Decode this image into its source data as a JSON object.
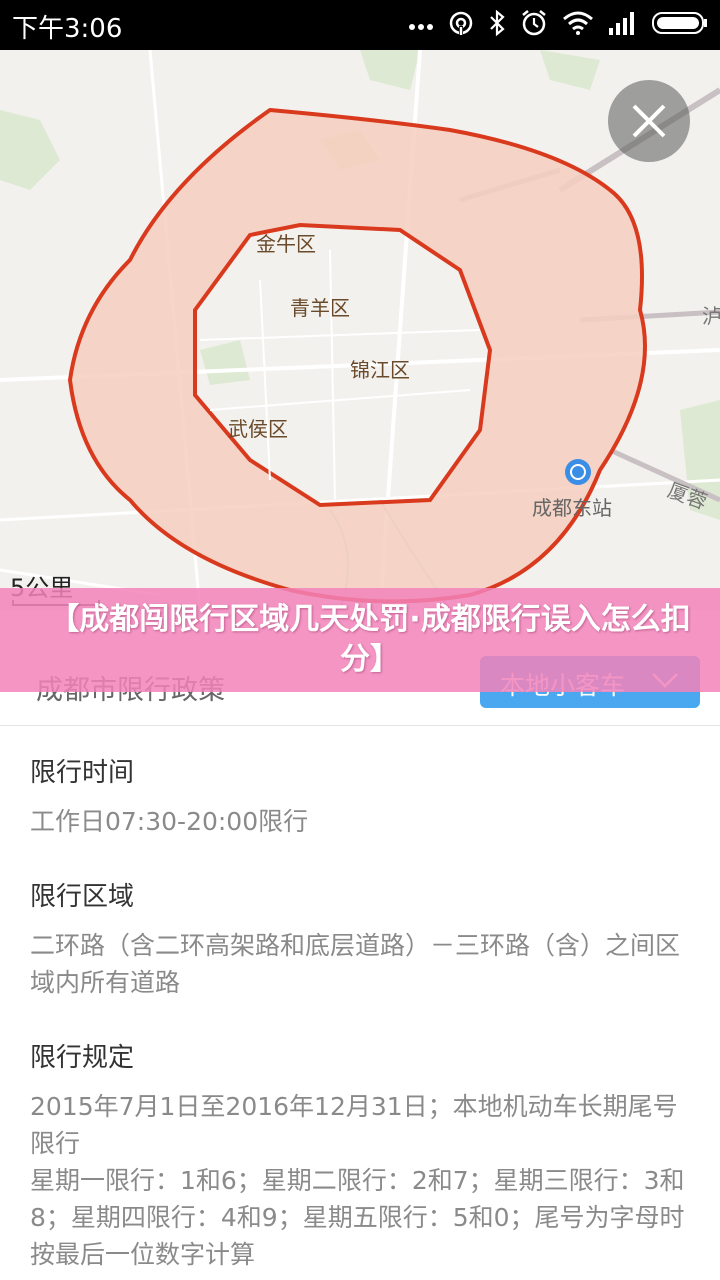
{
  "status_bar": {
    "time": "下午3:06"
  },
  "map": {
    "labels": {
      "jinniu": "金牛区",
      "qingyang": "青羊区",
      "jinjiang": "锦江区",
      "wuhou": "武侯区",
      "east_station": "成都东站",
      "xiarong": "厦蓉",
      "lu": "泸"
    },
    "scale": "5公里",
    "colors": {
      "zone_fill": "#f6cfc0",
      "zone_border": "#d93a1e"
    }
  },
  "banner": {
    "text": "【成都闯限行区域几天处罚·成都限行误入怎么扣分】"
  },
  "policy": {
    "title": "成都市限行政策",
    "vehicle_type": "本地小客车",
    "sections": [
      {
        "title": "限行时间",
        "body": "工作日07:30-20:00限行"
      },
      {
        "title": "限行区域",
        "body": "二环路（含二环高架路和底层道路）－三环路（含）之间区域内所有道路"
      },
      {
        "title": "限行规定",
        "body": "2015年7月1日至2016年12月31日；本地机动车长期尾号限行",
        "body2": "星期一限行：1和6；星期二限行：2和7；星期三限行：3和8；星期四限行：4和9；星期五限行：5和0；尾号为字母时按最后一位数字计算"
      }
    ]
  }
}
